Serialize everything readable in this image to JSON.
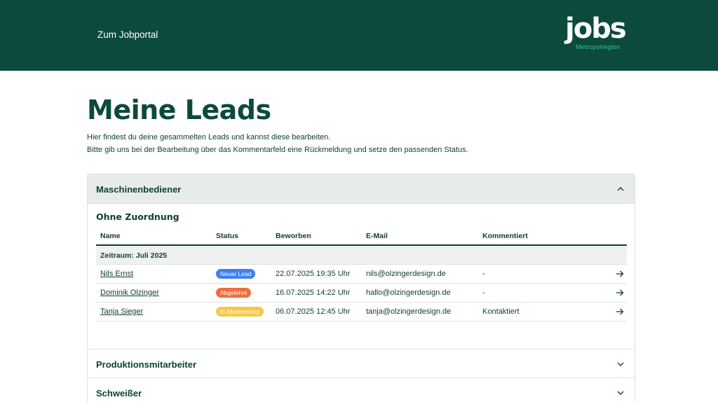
{
  "header": {
    "portal_link": "Zum Jobportal",
    "logo_word": "jobs",
    "logo_sub": "Metropolregion"
  },
  "page": {
    "title": "Meine Leads",
    "intro_line1": "Hier findest du deine gesammelten Leads und kannst diese bearbeiten.",
    "intro_line2": "Bitte gib uns bei der Bearbeitung über das Kommentarfeld eine Rückmeldung und setze den passenden Status."
  },
  "accordions": [
    {
      "title": "Maschinenbediener",
      "expanded": true,
      "group_title": "Ohne Zuordnung",
      "columns": [
        "Name",
        "Status",
        "Beworben",
        "E-Mail",
        "Kommentiert"
      ],
      "period_label": "Zeitraum: Juli 2025",
      "rows": [
        {
          "name": "Nils Ernst",
          "status": "Neuer Lead",
          "status_color": "#3f7ff0",
          "applied": "22.07.2025 19:35 Uhr",
          "email": "nils@olzingerdesign.de",
          "comment": "-"
        },
        {
          "name": "Dominik Olzinger",
          "status": "Abgelehnt",
          "status_color": "#f26b3a",
          "applied": "16.07.2025 14:22 Uhr",
          "email": "hallo@olzingerdesign.de",
          "comment": "-"
        },
        {
          "name": "Tanja Sieger",
          "status": "In Abstimmung",
          "status_color": "#f5c84a",
          "applied": "06.07.2025 12:45 Uhr",
          "email": "tanja@olzingerdesign.de",
          "comment": "Kontaktiert"
        }
      ]
    },
    {
      "title": "Produktionsmitarbeiter",
      "expanded": false
    },
    {
      "title": "Schweißer",
      "expanded": false
    }
  ],
  "icons": {
    "chevron_up": "chevron-up-icon",
    "chevron_down": "chevron-down-icon",
    "arrow_right": "arrow-right-icon"
  },
  "colors": {
    "brand": "#0b4a3d",
    "accent": "#35c27a"
  }
}
